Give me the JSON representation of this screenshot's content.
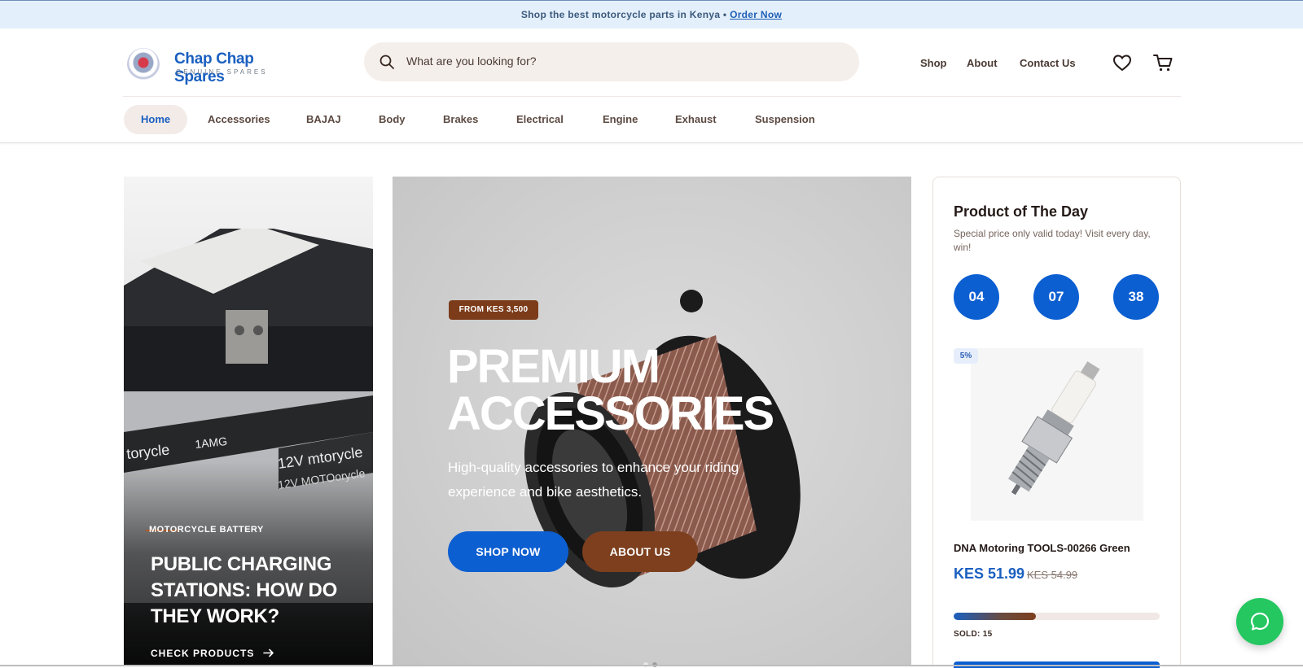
{
  "announcement": {
    "text": "Shop the best motorcycle parts in Kenya •",
    "link": "Order Now"
  },
  "brand": {
    "name": "Chap Chap Spares",
    "tagline": "GENUINE SPARES"
  },
  "search": {
    "placeholder": "What are you looking for?"
  },
  "header_nav": {
    "shop": "Shop",
    "about": "About",
    "contact": "Contact Us"
  },
  "categories": [
    "Home",
    "Accessories",
    "BAJAJ",
    "Body",
    "Brakes",
    "Electrical",
    "Engine",
    "Exhaust",
    "Suspension"
  ],
  "left_card": {
    "eyebrow": "MOTORCYCLE BATTERY",
    "title": "PUBLIC CHARGING STATIONS: HOW DO THEY WORK?",
    "cta": "CHECK PRODUCTS"
  },
  "hero": {
    "badge": "FROM KES 3,500",
    "title": "PREMIUM ACCESSORIES",
    "subtitle": "High-quality accessories to enhance your riding experience and bike aesthetics.",
    "primary_button": "SHOP NOW",
    "secondary_button": "ABOUT US"
  },
  "deal": {
    "title": "Product of The Day",
    "subtitle": "Special price only valid today! Visit every day, win!",
    "timer": [
      "04",
      "07",
      "38"
    ],
    "discount": "5%",
    "product_name": "DNA Motoring TOOLS-00266 Green",
    "price": "KES 51.99",
    "old_price": "KES 54.99",
    "sold_label": "SOLD:",
    "sold_count": "15",
    "sold_fraction": 0.4
  },
  "colors": {
    "primary_blue": "#0c5fd1",
    "brand_brown": "#7d3f1d",
    "whatsapp_green": "#24c760",
    "announcement_bg": "#e3effb"
  },
  "icons": [
    "search-icon",
    "heart-icon",
    "cart-icon",
    "arrow-right-icon",
    "chat-icon"
  ]
}
